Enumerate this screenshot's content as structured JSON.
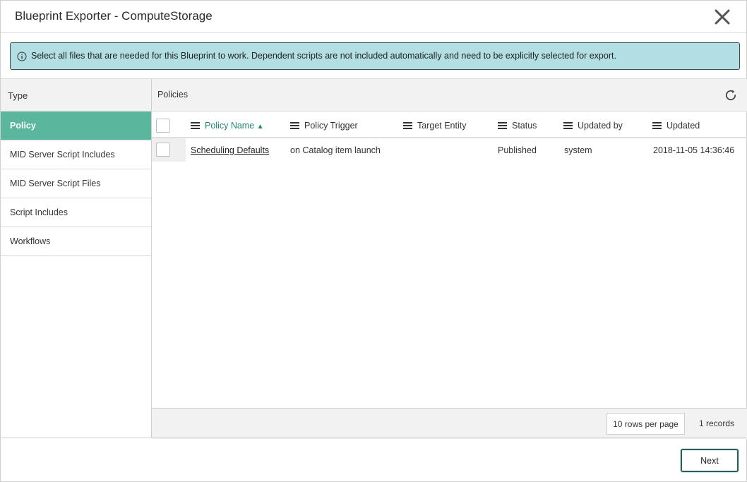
{
  "window": {
    "title": "Blueprint Exporter - ComputeStorage",
    "close_icon": "close-icon"
  },
  "alert": {
    "icon": "info-icon",
    "message": "Select all files that are needed for this Blueprint to work. Dependent scripts are not included automatically and need to be explicitly selected for export."
  },
  "sidebar": {
    "header": "Type",
    "items": [
      {
        "label": "Policy",
        "active": true
      },
      {
        "label": "MID Server Script Includes",
        "active": false
      },
      {
        "label": "MID Server Script Files",
        "active": false
      },
      {
        "label": "Script Includes",
        "active": false
      },
      {
        "label": "Workflows",
        "active": false
      }
    ]
  },
  "main": {
    "header": "Policies",
    "refresh_icon": "refresh-icon",
    "columns": [
      {
        "label": "Policy Name",
        "sorted": "ascending"
      },
      {
        "label": "Policy Trigger"
      },
      {
        "label": "Target Entity"
      },
      {
        "label": "Status"
      },
      {
        "label": "Updated by"
      },
      {
        "label": "Updated"
      }
    ],
    "sort_indicator": "▲",
    "rows": [
      {
        "checked": false,
        "cells": [
          "Scheduling Defaults",
          "on Catalog item launch",
          "",
          "Published",
          "system",
          "2018-11-05 14:36:46"
        ]
      }
    ],
    "footer": {
      "rows_per_page": "10 rows per page",
      "records": "1 records"
    }
  },
  "actions": {
    "next_label": "Next"
  },
  "colors": {
    "accent": "#5ab69c",
    "sorted_header": "#1e8a6e",
    "alert_bg": "#b1dfe3"
  }
}
